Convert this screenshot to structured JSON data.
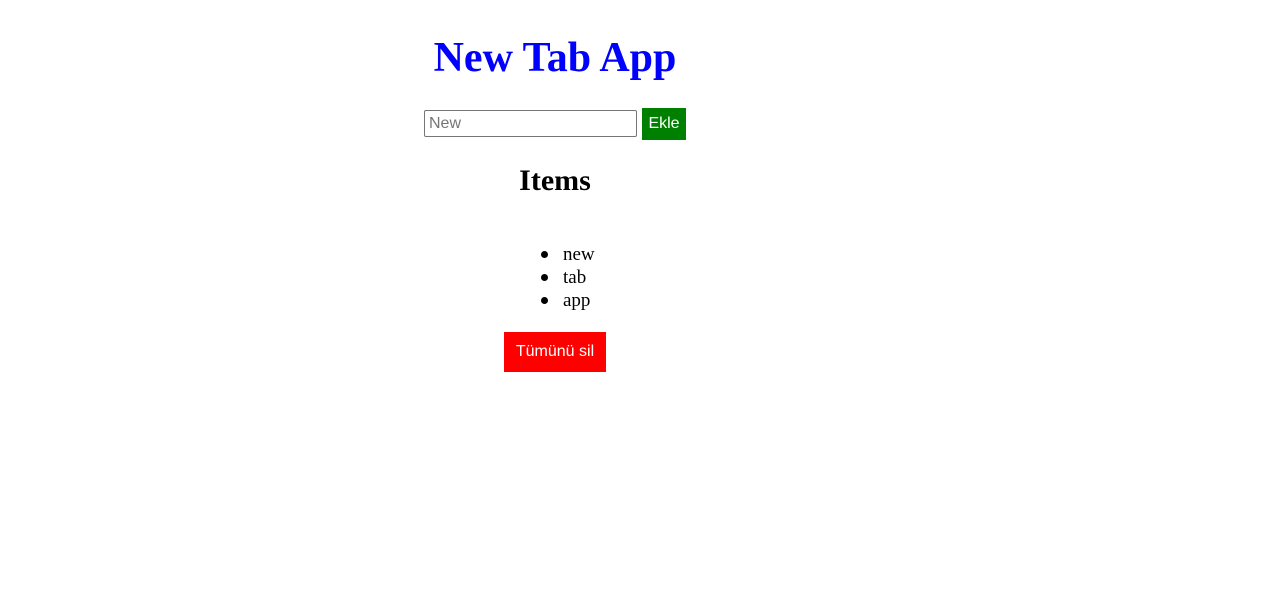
{
  "app": {
    "title": "New Tab App",
    "title_color": "#0000ff"
  },
  "add_form": {
    "input_placeholder": "New",
    "input_value": "",
    "add_button_label": "Ekle",
    "add_button_color": "#008000"
  },
  "items_section": {
    "heading": "Items",
    "items": [
      {
        "label": "new"
      },
      {
        "label": "tab"
      },
      {
        "label": "app"
      }
    ]
  },
  "actions": {
    "delete_all_label": "Tümünü sil",
    "delete_all_color": "#ff0000"
  }
}
